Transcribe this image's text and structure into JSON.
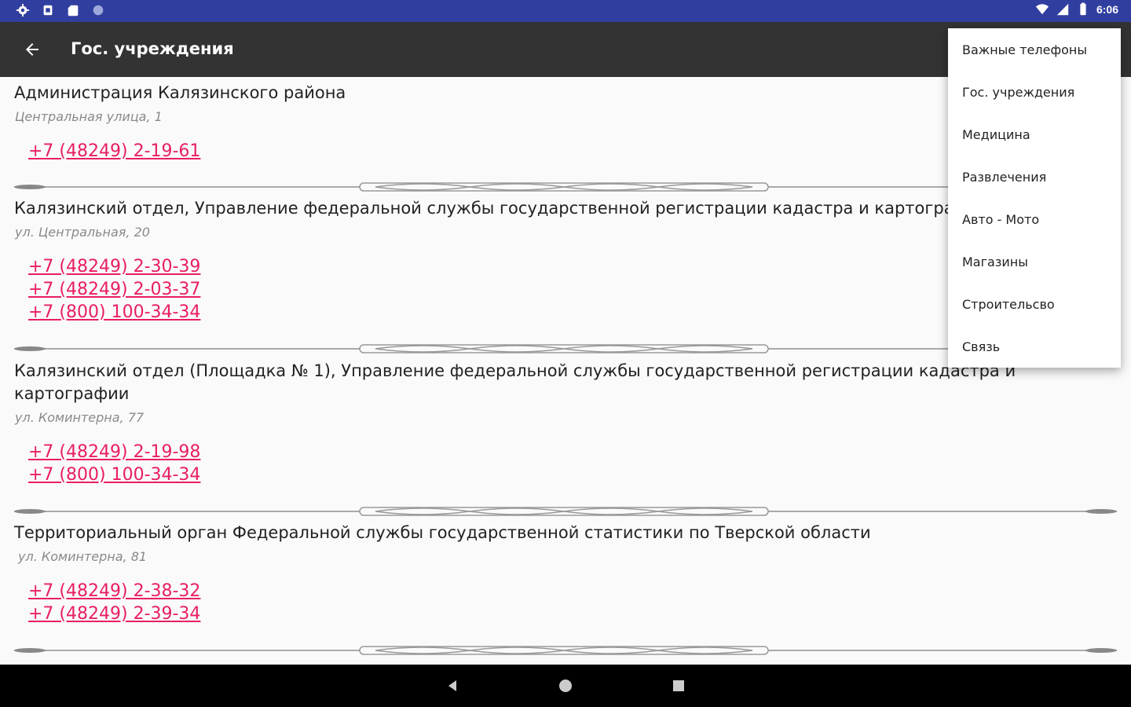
{
  "status_bar": {
    "time": "6:06",
    "icons": [
      "settings-icon",
      "sim-icon",
      "sd-card-icon",
      "circle-icon",
      "wifi-icon",
      "signal-icon",
      "battery-icon"
    ]
  },
  "app_bar": {
    "title": "Гос. учреждения",
    "back_icon": "arrow-back-icon"
  },
  "entries": [
    {
      "title": "Администрация Калязинского района",
      "address": "Центральная улица, 1",
      "phones": [
        "+7 (48249) 2-19-61"
      ]
    },
    {
      "title": "Калязинский отдел, Управление федеральной службы государственной регистрации кадастра и картографии",
      "address": "ул. Центральная, 20",
      "phones": [
        "+7 (48249) 2-30-39",
        "+7 (48249) 2-03-37",
        "+7 (800) 100-34-34"
      ]
    },
    {
      "title": "Калязинский отдел (Площадка № 1), Управление федеральной службы государственной регистрации кадастра и картографии",
      "address": "ул. Коминтерна, 77",
      "phones": [
        "+7 (48249) 2-19-98",
        "+7 (800) 100-34-34"
      ]
    },
    {
      "title": "Территориальный орган Федеральной службы государственной статистики по Тверской области",
      "address": "ул. Коминтерна, 81",
      "phones": [
        "+7 (48249) 2-38-32",
        "+7 (48249) 2-39-34"
      ]
    }
  ],
  "menu": {
    "items": [
      "Важные телефоны",
      "Гос. учреждения",
      "Медицина",
      "Развлечения",
      "Авто - Мото",
      "Магазины",
      "Строительсво",
      "Связь"
    ]
  },
  "colors": {
    "status_bar": "#303f9f",
    "app_bar": "#333333",
    "phone_link": "#e91e63",
    "nav_bar": "#000000"
  }
}
